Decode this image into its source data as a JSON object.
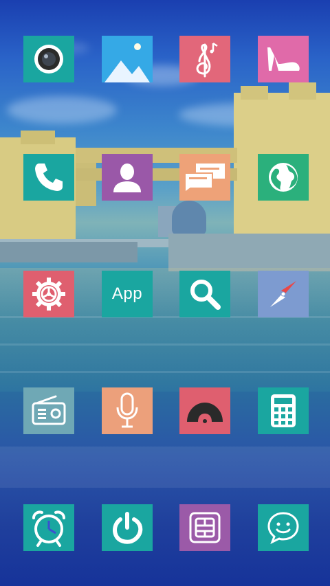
{
  "screen": "home-screen",
  "colors": {
    "teal": "#1aa6a0",
    "sky_blue": "#35a9e6",
    "coral": "#e2677a",
    "pink": "#e06aa9",
    "purple": "#9a58a8",
    "peach": "#eea278",
    "green": "#2bb07c",
    "periwinkle": "#7d9bd0",
    "steel": "#6fa8b5",
    "orange": "#eca07b",
    "red": "#df5f6f",
    "violet": "#9b5aa8",
    "white": "#ffffff"
  },
  "apps": [
    {
      "icon": "camera-icon"
    },
    {
      "icon": "gallery-icon"
    },
    {
      "icon": "music-icon"
    },
    {
      "icon": "high-heel-icon"
    },
    {
      "icon": "phone-icon"
    },
    {
      "icon": "contacts-icon"
    },
    {
      "icon": "messages-icon"
    },
    {
      "icon": "globe-icon"
    },
    {
      "icon": "settings-gear-icon"
    },
    {
      "icon": "app-store-icon",
      "label": "App"
    },
    {
      "icon": "search-icon"
    },
    {
      "icon": "compass-icon"
    },
    {
      "icon": "radio-icon"
    },
    {
      "icon": "microphone-icon"
    },
    {
      "icon": "vinyl-record-icon"
    },
    {
      "icon": "calculator-icon"
    },
    {
      "icon": "alarm-clock-icon"
    },
    {
      "icon": "power-icon"
    },
    {
      "icon": "sim-card-icon"
    },
    {
      "icon": "chat-smiley-icon"
    }
  ]
}
